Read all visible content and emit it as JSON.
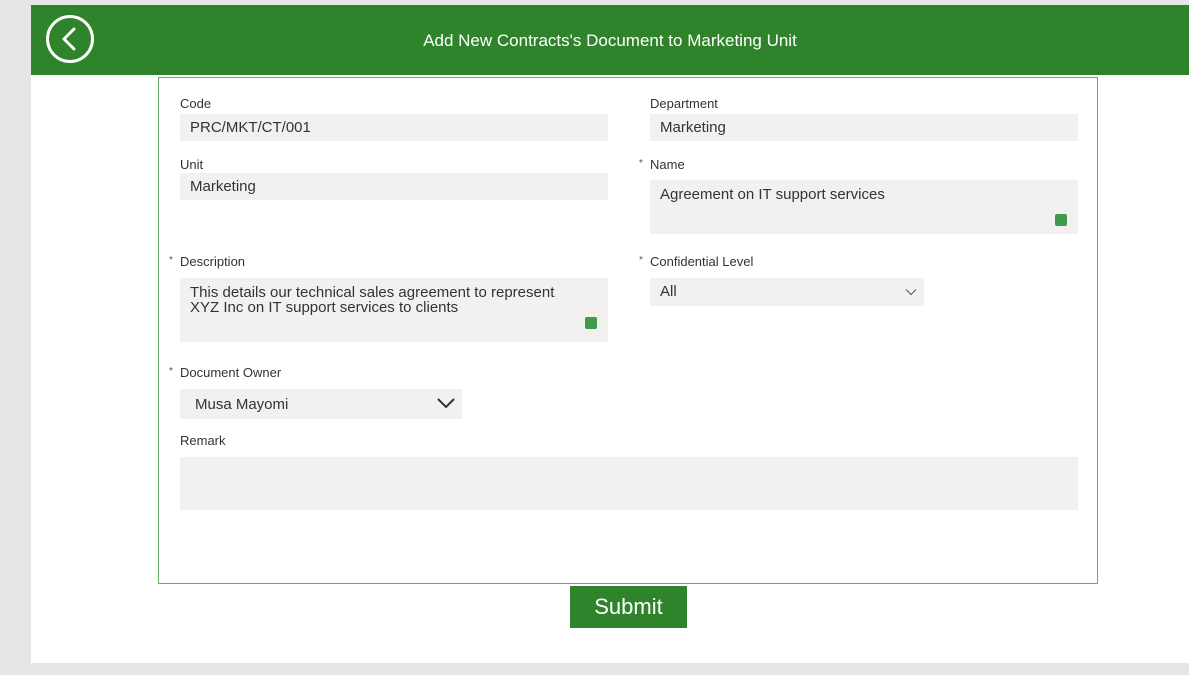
{
  "header": {
    "title": "Add New Contracts's Document to Marketing Unit",
    "back_icon": "chevron-left-icon",
    "background_color": "#2e832b"
  },
  "form": {
    "code": {
      "label": "Code",
      "value": "PRC/MKT/CT/001"
    },
    "department": {
      "label": "Department",
      "value": "Marketing"
    },
    "unit": {
      "label": "Unit",
      "value": "Marketing"
    },
    "name": {
      "required_mark": "*",
      "label": "Name",
      "value": "Agreement on IT support services"
    },
    "description": {
      "required_mark": "*",
      "label": "Description",
      "value": "This details our technical sales agreement to represent XYZ Inc on IT support services to clients"
    },
    "confidential_level": {
      "required_mark": "*",
      "label": "Confidential Level",
      "selected": "All"
    },
    "document_owner": {
      "required_mark": "*",
      "label": "Document Owner",
      "selected": "Musa Mayomi"
    },
    "remark": {
      "label": "Remark",
      "value": ""
    }
  },
  "submit": {
    "label": "Submit"
  }
}
